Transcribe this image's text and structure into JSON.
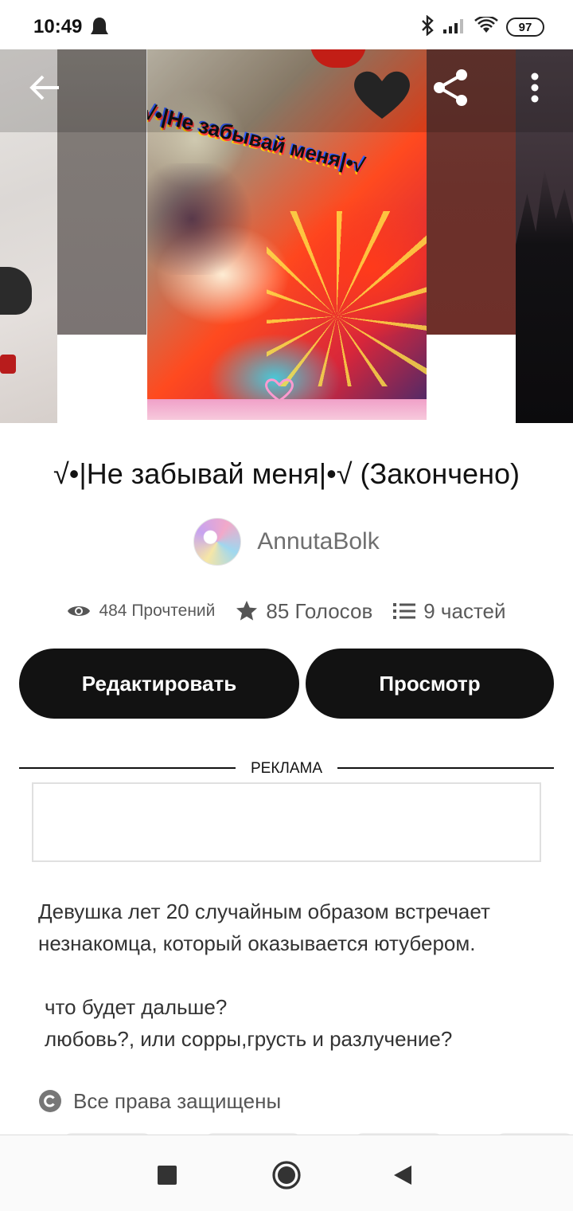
{
  "status_bar": {
    "time": "10:49",
    "battery": "97",
    "icons": [
      "ghost-icon",
      "bluetooth-icon",
      "signal-icon",
      "wifi-icon",
      "battery-icon"
    ]
  },
  "toolbar": {
    "back_icon": "arrow-left-icon",
    "share_icon": "share-icon",
    "more_icon": "more-vertical-icon"
  },
  "cover": {
    "text": "√•|Не забывай меня|•√"
  },
  "story": {
    "title": "√•|Не забывай меня|•√ (Закончено)",
    "author": "AnnutaBolk",
    "stats": {
      "reads": "484 Прочтений",
      "votes": "85 Голосов",
      "parts": "9 частей"
    }
  },
  "actions": {
    "edit_label": "Редактировать",
    "view_label": "Просмотр"
  },
  "ad": {
    "label": "РЕКЛАМА"
  },
  "description": {
    "line1": "Девушка лет 20 случайным образом встречает незнакомца, который оказывается ютубером.",
    "line2": "что будет дальше?",
    "line3": "любовь?, или сорры,грусть и разлучение?"
  },
  "copyright": {
    "text": "Все права защищены"
  },
  "colors": {
    "primary_button": "#121212",
    "text_primary": "#121212",
    "text_secondary": "#6f6f6f",
    "divider": "#121212",
    "ad_border": "#e0e0e0"
  }
}
